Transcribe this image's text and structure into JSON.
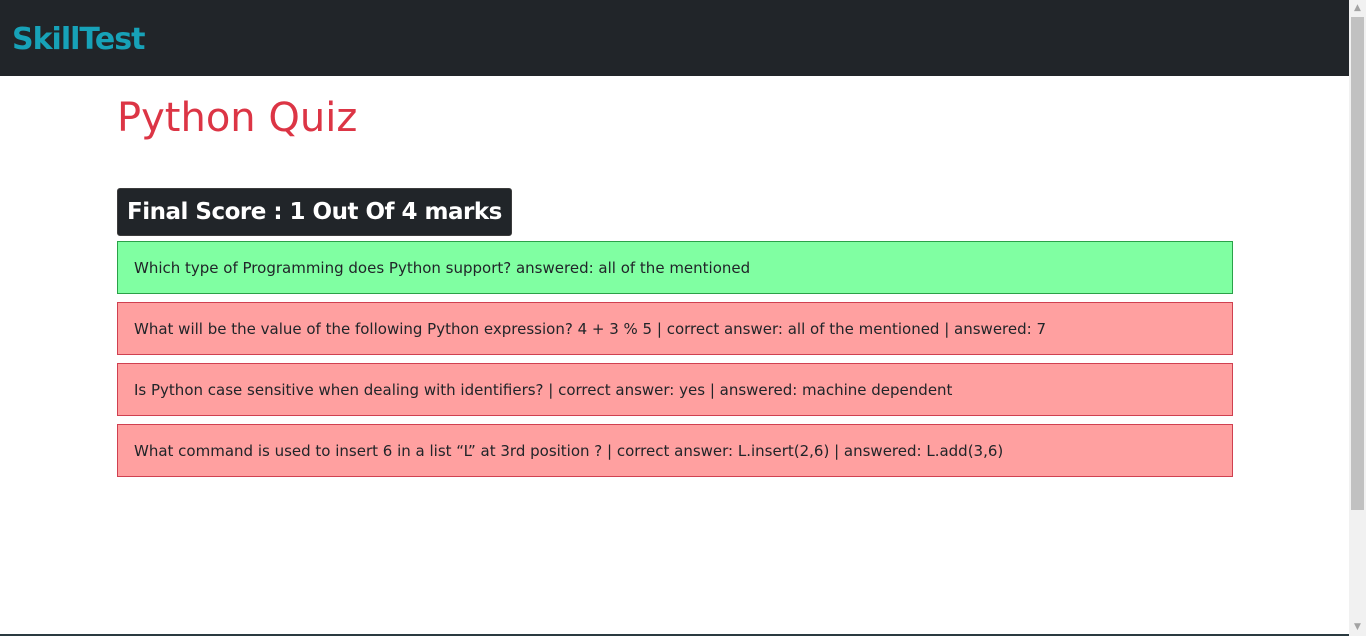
{
  "navbar": {
    "brand": "SkillTest"
  },
  "main": {
    "title": "Python Quiz",
    "score": "Final Score : 1 Out Of 4 marks",
    "results": [
      {
        "status": "correct",
        "text": "Which type of Programming does Python support? answered: all of the mentioned"
      },
      {
        "status": "wrong",
        "text": "What will be the value of the following Python expression? 4 + 3 % 5 | correct answer: all of the mentioned | answered: 7"
      },
      {
        "status": "wrong",
        "text": "Is Python case sensitive when dealing with identifiers? | correct answer: yes | answered: machine dependent"
      },
      {
        "status": "wrong",
        "text": "What command is used to insert 6 in a list “L” at 3rd position ? | correct answer: L.insert(2,6) | answered: L.add(3,6)"
      }
    ]
  },
  "colors": {
    "navbar_bg": "#212529",
    "brand": "#17a2b8",
    "title": "#dc3545",
    "correct_bg": "#80ffa2",
    "wrong_bg": "#ffa0a0"
  },
  "scrollbar": {
    "up_icon": "triangle-up-icon",
    "down_icon": "triangle-down-icon"
  }
}
